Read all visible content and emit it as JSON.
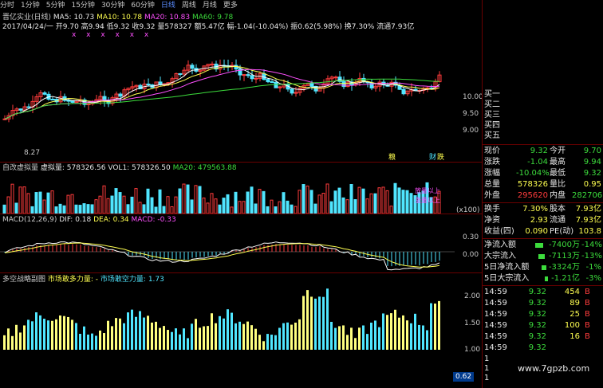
{
  "toolbar": {
    "items": [
      "分时",
      "1分钟",
      "5分钟",
      "15分钟",
      "30分钟",
      "60分钟",
      "日线",
      "周线",
      "月线",
      "更多"
    ],
    "active_index": 6
  },
  "kline_header": {
    "name": "晋亿实业(日线)",
    "ma5": "MA5: 10.73",
    "ma10": "MA10: 10.78",
    "ma20": "MA20: 10.83",
    "ma60": "MA60: 9.78",
    "ohlc": "2017/04/24/一 开9.70 高9.94 低9.32 收9.32 量578327 额5.47亿 幅-1.04(-10.04%) 振0.62(5.98%) 换7.30% 流通7.93亿",
    "ylabels": [
      "10.00",
      "9.50",
      "9.00"
    ],
    "low_marker": "8.27",
    "markers": [
      "粮",
      "财",
      "跌"
    ],
    "x_marks": "x x x  x x x"
  },
  "volume_header": {
    "title": "自改虚拟量",
    "vlabel": "虚拟量: 578326.56",
    "vol1": "VOL1: 578326.50",
    "ma20": "MA20: 479563.88",
    "tag": "(x100)",
    "note": "放量以上\n涨量以上"
  },
  "macd_header": {
    "title": "MACD(12,26,9)",
    "dif": "DIF: 0.18",
    "dea": "DEA: 0.34",
    "macd": "MACD: -0.33",
    "ylabels": [
      "0.30",
      "0.00"
    ]
  },
  "duokong_header": {
    "title": "多空战略副图",
    "buy": "市场敢多力量: -",
    "sell": "市场敢空力量: 1.73",
    "ylabels": [
      "2.00",
      "1.50",
      "1.00"
    ],
    "value_box": "0.62"
  },
  "right": {
    "asks": [
      "买一",
      "买二",
      "买三",
      "买四",
      "买五"
    ],
    "quote": [
      {
        "l": "现价",
        "v": "9.32",
        "vc": "green",
        "l2": "今开",
        "v2": "9.70",
        "v2c": "green"
      },
      {
        "l": "涨跌",
        "v": "-1.04",
        "vc": "green",
        "l2": "最高",
        "v2": "9.94",
        "v2c": "green"
      },
      {
        "l": "涨幅",
        "v": "-10.04%",
        "vc": "green",
        "l2": "最低",
        "v2": "9.32",
        "v2c": "green"
      },
      {
        "l": "总量",
        "v": "578326",
        "vc": "yellow",
        "l2": "量比",
        "v2": "0.95",
        "v2c": "yellow"
      },
      {
        "l": "外盘",
        "v": "295620",
        "vc": "red",
        "l2": "内盘",
        "v2": "282706",
        "v2c": "green"
      }
    ],
    "stats": [
      {
        "l": "换手",
        "v": "7.30%",
        "l2": "股本",
        "v2": "7.93亿"
      },
      {
        "l": "净资",
        "v": "2.93",
        "l2": "流通",
        "v2": "7.93亿"
      },
      {
        "l": "收益(四)",
        "v": "0.090",
        "l2": "PE(动)",
        "v2": "103.8"
      }
    ],
    "flows": [
      {
        "l": "净流入额",
        "v": "-7400万",
        "p": "-14%"
      },
      {
        "l": "大宗流入",
        "v": "-7113万",
        "p": "-13%"
      },
      {
        "l": "5日净流入额",
        "v": "-3324万",
        "p": "-1%"
      },
      {
        "l": "5日大宗流入",
        "v": "-1.21亿",
        "p": "-3%"
      }
    ],
    "trades": [
      {
        "t": "14:59",
        "p": "9.32",
        "q": "454",
        "s": "B"
      },
      {
        "t": "14:59",
        "p": "9.32",
        "q": "89",
        "s": "B"
      },
      {
        "t": "14:59",
        "p": "9.32",
        "q": "25",
        "s": "B"
      },
      {
        "t": "14:59",
        "p": "9.32",
        "q": "100",
        "s": "B"
      },
      {
        "t": "14:59",
        "p": "9.32",
        "q": "16",
        "s": "B"
      },
      {
        "t": "14:59",
        "p": "9.32",
        "q": "",
        "s": ""
      }
    ],
    "tail_ones": [
      "1",
      "1",
      "1"
    ],
    "watermark": "www.7gpzb.com"
  }
}
